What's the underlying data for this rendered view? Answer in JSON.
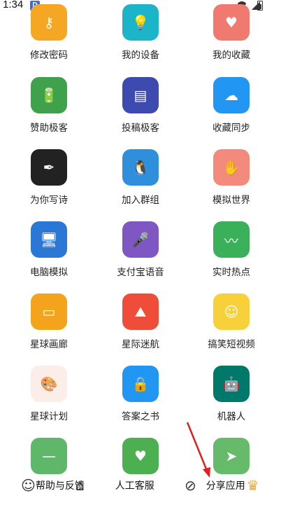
{
  "status_bar": {
    "time": "1:34",
    "app_badge": "D"
  },
  "grid": {
    "items": [
      {
        "label": "修改密码",
        "icon": "key-icon",
        "color": "#f5a623",
        "glyph": "⚷"
      },
      {
        "label": "我的设备",
        "icon": "lightbulb-icon",
        "color": "#1cb4c8",
        "glyph": "💡"
      },
      {
        "label": "我的收藏",
        "icon": "heart-icon",
        "color": "#f07a6f",
        "glyph": "♥"
      },
      {
        "label": "赞助极客",
        "icon": "battery-icon",
        "color": "#3fa14c",
        "glyph": "🔋"
      },
      {
        "label": "投稿极客",
        "icon": "message-icon",
        "color": "#3d4bb0",
        "glyph": "▤"
      },
      {
        "label": "收藏同步",
        "icon": "cloud-icon",
        "color": "#2196f3",
        "glyph": "☁"
      },
      {
        "label": "为你写诗",
        "icon": "pen-nib-icon",
        "color": "#222222",
        "glyph": "✒"
      },
      {
        "label": "加入群组",
        "icon": "penguin-icon",
        "color": "#2f8fdc",
        "glyph": "🐧"
      },
      {
        "label": "模拟世界",
        "icon": "paw-icon",
        "color": "#f38b7c",
        "glyph": "✋"
      },
      {
        "label": "电脑模拟",
        "icon": "monitor-icon",
        "color": "#2b77d6",
        "glyph": "🖥"
      },
      {
        "label": "支付宝语音",
        "icon": "microphone-icon",
        "color": "#7e57c2",
        "glyph": "🎤"
      },
      {
        "label": "实时热点",
        "icon": "trending-icon",
        "color": "#3ab05a",
        "glyph": "〰"
      },
      {
        "label": "星球画廊",
        "icon": "card-icon",
        "color": "#f4a41c",
        "glyph": "▭"
      },
      {
        "label": "星际迷航",
        "icon": "mountain-icon",
        "color": "#ef4d3a",
        "glyph": "⛰"
      },
      {
        "label": "搞笑短视频",
        "icon": "smiley-icon",
        "color": "#f8d13a",
        "glyph": "☺"
      },
      {
        "label": "星球计划",
        "icon": "palette-icon",
        "color": "#fbeee8",
        "glyph": "🎨"
      },
      {
        "label": "答案之书",
        "icon": "lock-icon",
        "color": "#2196f3",
        "glyph": "🔒"
      },
      {
        "label": "机器人",
        "icon": "robot-icon",
        "color": "#00796b",
        "glyph": "🤖"
      },
      {
        "label": "",
        "icon": "minus-icon",
        "color": "#5fb86a",
        "glyph": "—"
      },
      {
        "label": "",
        "icon": "person-heart-icon",
        "color": "#4caf50",
        "glyph": "♥"
      },
      {
        "label": "",
        "icon": "send-icon",
        "color": "#66bb6a",
        "glyph": "➤"
      }
    ]
  },
  "bottom_nav": {
    "help_label": "帮助与反馈",
    "service_label": "人工客服",
    "share_label": "分享应用"
  }
}
